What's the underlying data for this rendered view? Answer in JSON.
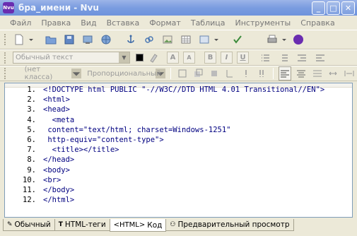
{
  "window": {
    "title": "бра_имени - Nvu",
    "app_icon_text": "Nvu",
    "minimize": "_",
    "maximize": "□",
    "close": "✕"
  },
  "menu": [
    "Файл",
    "Правка",
    "Вид",
    "Вставка",
    "Формат",
    "Таблица",
    "Инструменты",
    "Справка"
  ],
  "toolbar_format": {
    "paragraph_style": "Обычный текст",
    "font_size_up": "A",
    "font_size_down": "A",
    "bold": "B",
    "italic": "I",
    "underline": "U"
  },
  "toolbar_css": {
    "css_class": "(нет класса)",
    "font_family": "Пропорциональный"
  },
  "editor": {
    "lines": [
      {
        "n": "1.",
        "text": "<!DOCTYPE html PUBLIC \"-//W3C//DTD HTML 4.01 Transitional//EN\">"
      },
      {
        "n": "2.",
        "text": "<html>"
      },
      {
        "n": "3.",
        "text": "<head>"
      },
      {
        "n": "4.",
        "text": "  <meta"
      },
      {
        "n": "5.",
        "text": " content=\"text/html; charset=Windows-1251\""
      },
      {
        "n": "6.",
        "text": " http-equiv=\"content-type\">"
      },
      {
        "n": "7.",
        "text": "  <title></title>"
      },
      {
        "n": "8.",
        "text": "</head>"
      },
      {
        "n": "9.",
        "text": "<body>"
      },
      {
        "n": "10.",
        "text": "<br>"
      },
      {
        "n": "11.",
        "text": "</body>"
      },
      {
        "n": "12.",
        "text": "</html>"
      }
    ]
  },
  "tabs": [
    {
      "icon": "✎",
      "label": "Обычный"
    },
    {
      "icon": "T",
      "label": "HTML-теги"
    },
    {
      "icon": "<HTML>",
      "label": "Код"
    },
    {
      "icon": "⚇",
      "label": "Предварительный просмотр"
    }
  ],
  "colors": {
    "title_gradient_top": "#9cb4e8",
    "code_text": "#000080",
    "app_icon": "#6a2db0"
  }
}
